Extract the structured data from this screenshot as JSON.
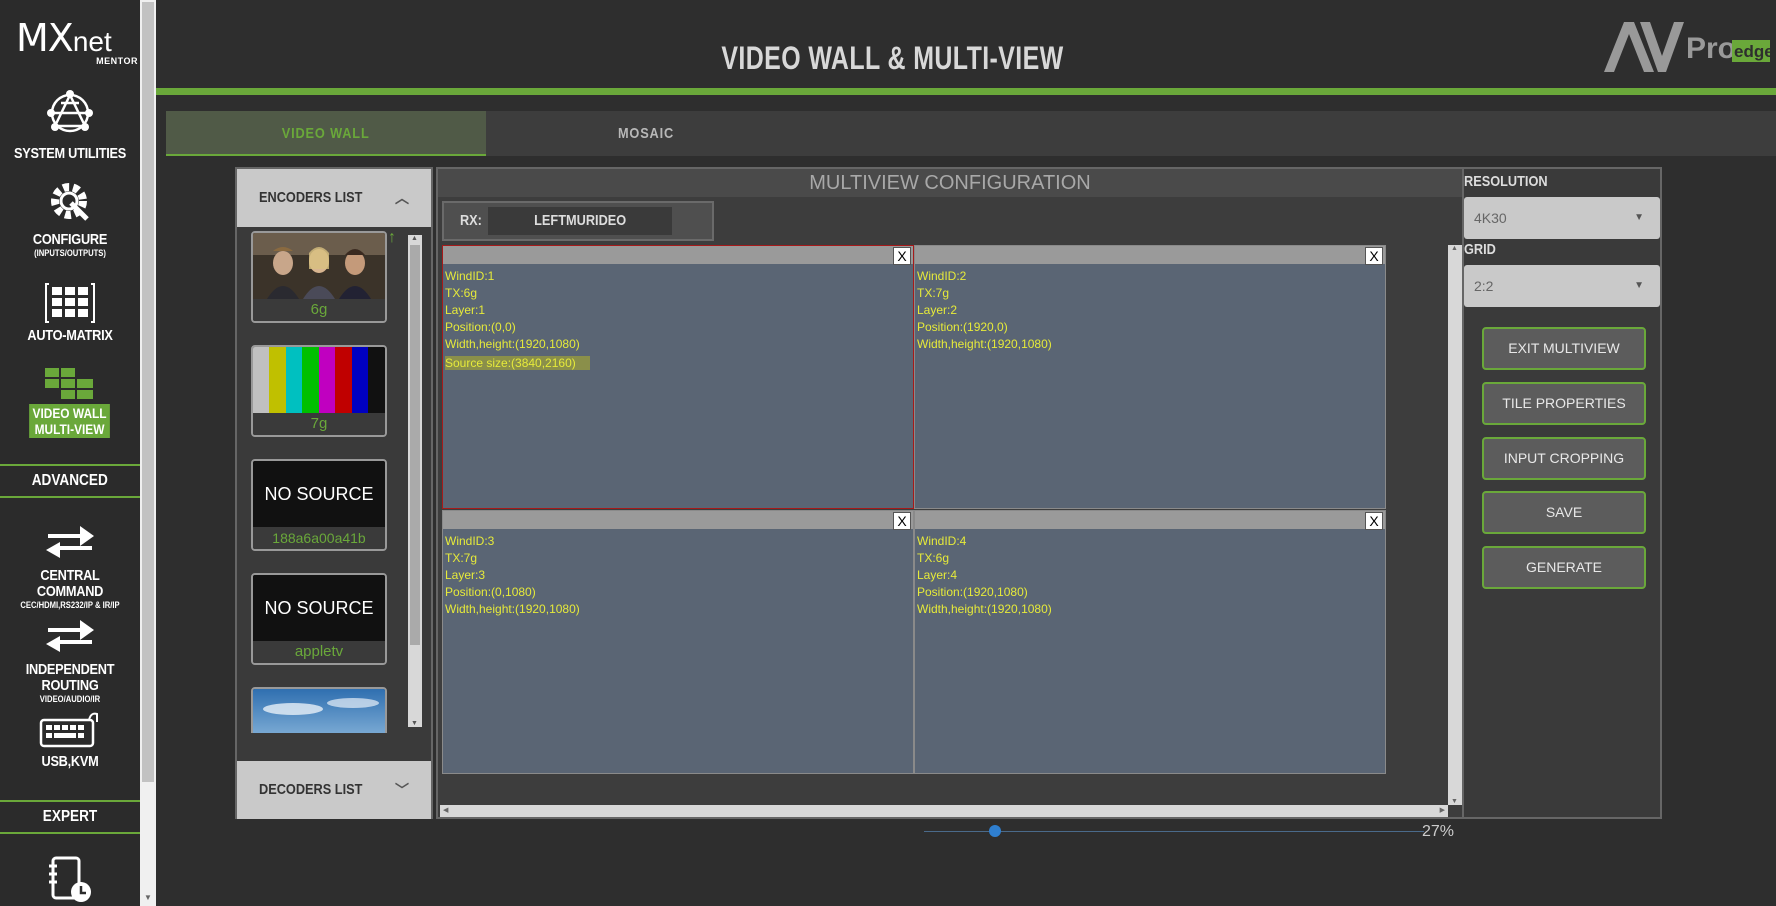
{
  "sidebar": {
    "logo": {
      "main": "MX",
      "suffix": "net",
      "sub": "MENTOR"
    },
    "items": [
      {
        "label": "SYSTEM UTILITIES",
        "sub": ""
      },
      {
        "label": "CONFIGURE",
        "sub": "(INPUTS/OUTPUTS)"
      },
      {
        "label": "AUTO-MATRIX",
        "sub": ""
      },
      {
        "label": "VIDEO WALL",
        "label2": "MULTI-VIEW",
        "active": true
      },
      {
        "label": "CENTRAL COMMAND",
        "sub": "CEC/HDMI,RS232/IP & IR/IP"
      },
      {
        "label": "INDEPENDENT ROUTING",
        "sub": "VIDEO/AUDIO/IR"
      },
      {
        "label": "USB,KVM",
        "sub": ""
      }
    ],
    "sections": [
      "ADVANCED",
      "EXPERT"
    ]
  },
  "header": {
    "title": "VIDEO WALL & MULTI-VIEW",
    "brand": {
      "av": "AV",
      "pro": "Pro",
      "edge": "edge"
    }
  },
  "tabs": [
    {
      "label": "VIDEO WALL",
      "active": true
    },
    {
      "label": "MOSAIC",
      "active": false
    }
  ],
  "encoders": {
    "header": "ENCODERS LIST",
    "items": [
      {
        "name": "6g",
        "preview": "photo"
      },
      {
        "name": "7g",
        "preview": "color-bars"
      },
      {
        "name": "188a6a00a41b",
        "preview": "no-source",
        "preview_text": "NO SOURCE"
      },
      {
        "name": "appletv",
        "preview": "no-source",
        "preview_text": "NO SOURCE"
      },
      {
        "name": "",
        "preview": "sky"
      }
    ]
  },
  "decoders": {
    "header": "DECODERS LIST"
  },
  "multiview": {
    "title": "MULTIVIEW CONFIGURATION",
    "rx_label": "RX:",
    "rx_value": "LEFTMURIDEO",
    "windows": [
      {
        "close": "X",
        "selected": true,
        "lines": [
          "WindID:1",
          "TX:6g",
          "Layer:1",
          "Position:(0,0)",
          "Width,height:(1920,1080)"
        ],
        "highlight": "Source size:(3840,2160)"
      },
      {
        "close": "X",
        "selected": false,
        "lines": [
          "WindID:2",
          "TX:7g",
          "Layer:2",
          "Position:(1920,0)",
          "Width,height:(1920,1080)"
        ]
      },
      {
        "close": "X",
        "selected": false,
        "lines": [
          "WindID:3",
          "TX:7g",
          "Layer:3",
          "Position:(0,1080)",
          "Width,height:(1920,1080)"
        ]
      },
      {
        "close": "X",
        "selected": false,
        "lines": [
          "WindID:4",
          "TX:6g",
          "Layer:4",
          "Position:(1920,1080)",
          "Width,height:(1920,1080)"
        ]
      }
    ]
  },
  "settings": {
    "resolution_label": "RESOLUTION",
    "resolution_value": "4K30",
    "grid_label": "GRID",
    "grid_value": "2:2",
    "buttons": [
      "EXIT MULTIVIEW",
      "TILE PROPERTIES",
      "INPUT CROPPING",
      "SAVE",
      "GENERATE"
    ]
  },
  "zoom": {
    "value": "27%",
    "fraction": 0.27
  },
  "colors": {
    "accent": "#6aa83a",
    "window_bg": "#5a6574",
    "window_text": "#e6ea3a",
    "selected_border": "#a61a1a"
  }
}
